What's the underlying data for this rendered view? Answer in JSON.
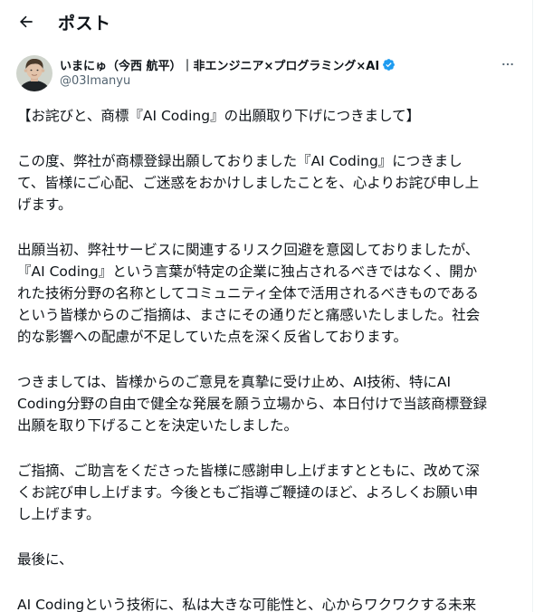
{
  "header": {
    "title": "ポスト"
  },
  "author": {
    "display_name": "いまにゅ（今西 航平）｜非エンジニア×プログラミング×AI",
    "handle": "@03Imanyu",
    "verified_color": "#1d9bf0"
  },
  "post": {
    "paragraphs": [
      [
        "【お詫びと、商標『AI Coding』の出願取り下げにつきまして】"
      ],
      [
        "この度、弊社が商標登録出願しておりました『AI Coding』につきまし",
        "て、皆様にご心配、ご迷惑をおかけしましたことを、心よりお詫び申し上",
        "げます。"
      ],
      [
        "出願当初、弊社サービスに関連するリスク回避を意図しておりましたが、",
        "『AI Coding』という言葉が特定の企業に独占されるべきではなく、開か",
        "れた技術分野の名称としてコミュニティ全体で活用されるべきものである",
        "という皆様からのご指摘は、まさにその通りだと痛感いたしました。社会",
        "的な影響への配慮が不足していた点を深く反省しております。"
      ],
      [
        "つきましては、皆様からのご意見を真摯に受け止め、AI技術、特にAI",
        "Coding分野の自由で健全な発展を願う立場から、本日付けで当該商標登録",
        "出願を取り下げることを決定いたしました。"
      ],
      [
        "ご指摘、ご助言をくださった皆様に感謝申し上げますとともに、改めて深",
        "くお詫び申し上げます。今後ともご指導ご鞭撻のほど、よろしくお願い申",
        "し上げます。"
      ],
      [
        "最後に、"
      ],
      [
        "AI Codingという技術に、私は大きな可能性と、心からワクワクする未来"
      ]
    ]
  },
  "icons": {
    "back": "arrow-left-icon",
    "more": "more-horizontal-icon",
    "verified": "verified-badge-icon"
  }
}
